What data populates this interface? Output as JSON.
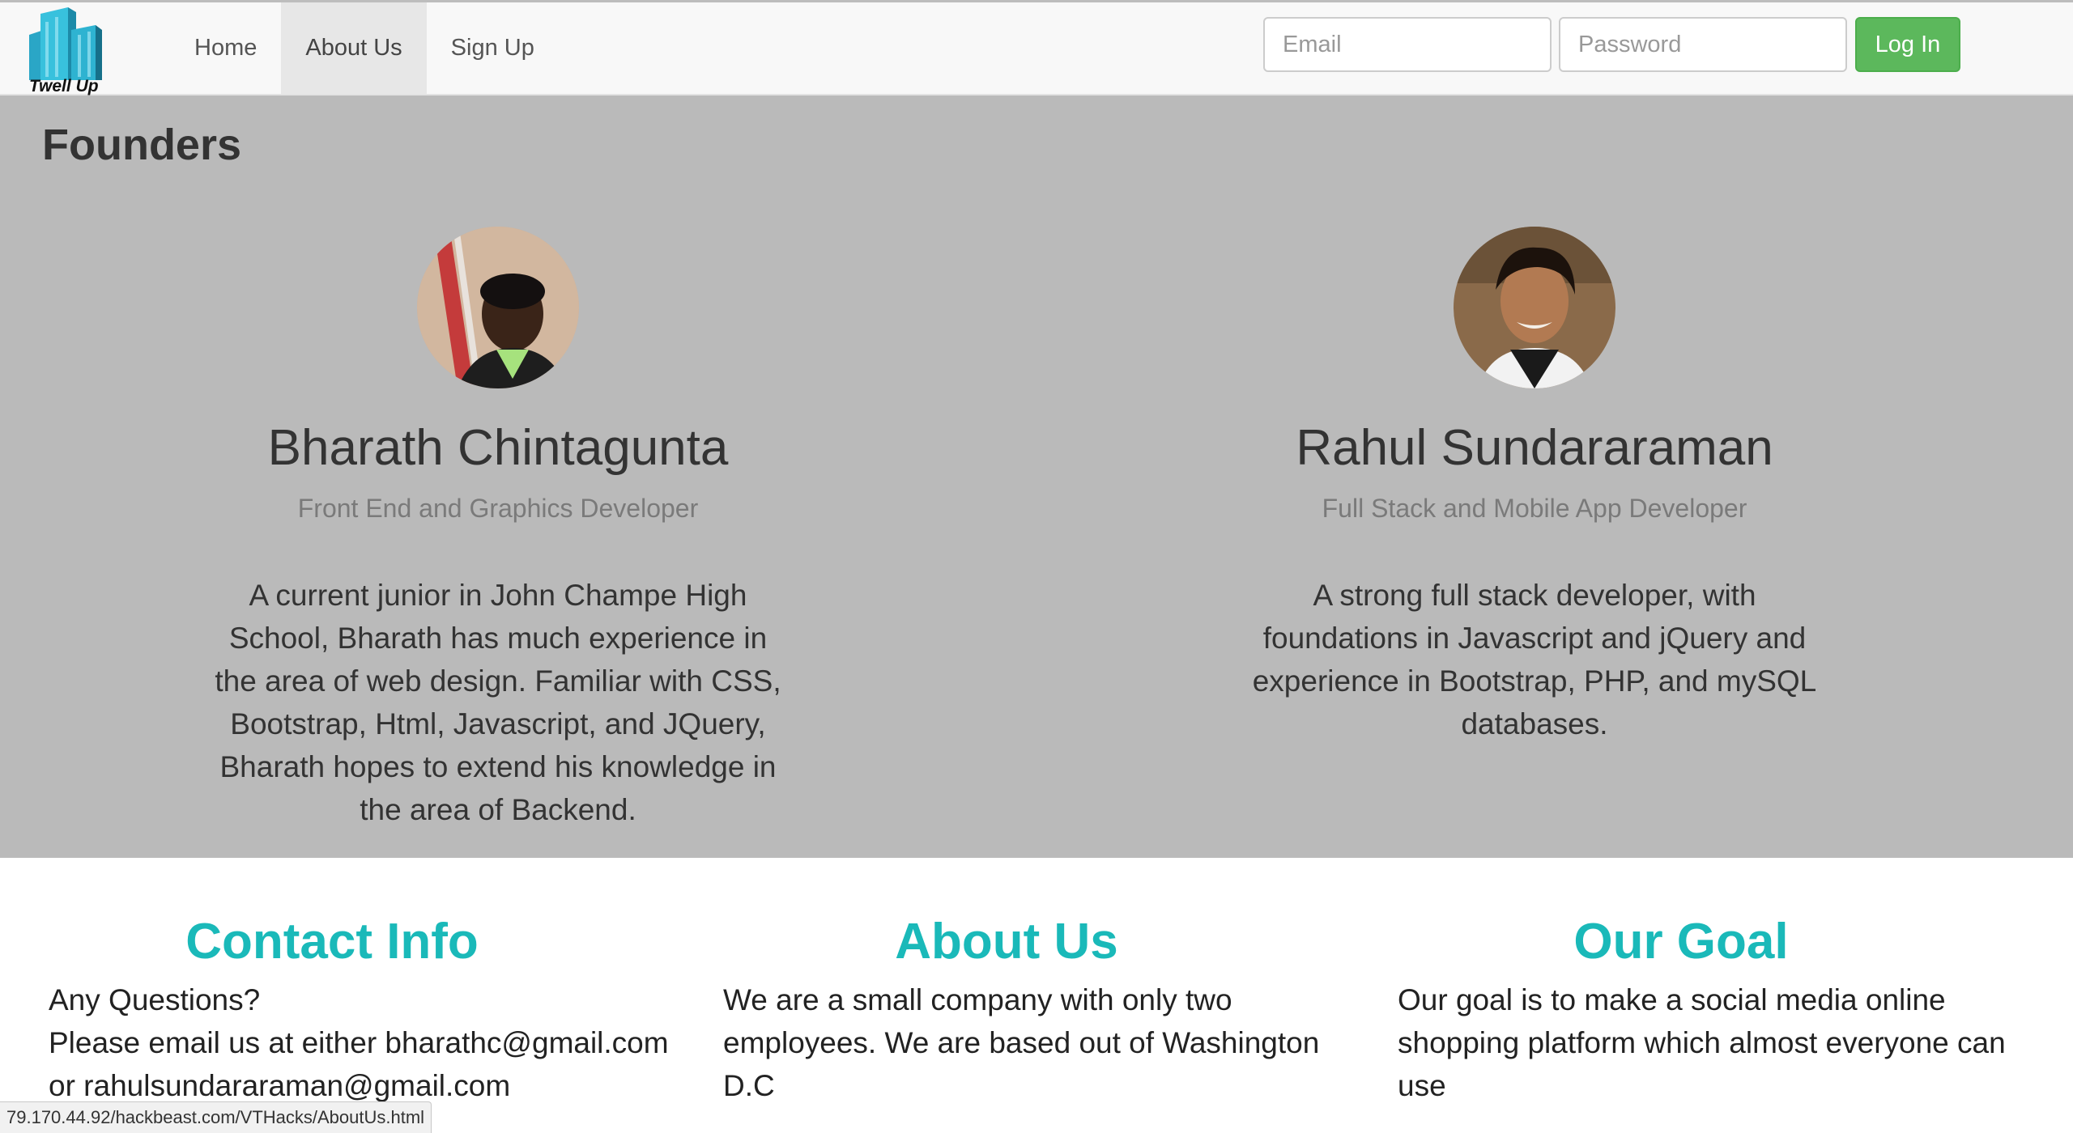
{
  "navbar": {
    "brand_name": "Twell Up",
    "links": [
      {
        "label": "Home",
        "active": false
      },
      {
        "label": "About Us",
        "active": true
      },
      {
        "label": "Sign Up",
        "active": false
      }
    ],
    "email_placeholder": "Email",
    "password_placeholder": "Password",
    "login_label": "Log In",
    "login_color": "#5cb85c"
  },
  "founders": {
    "title": "Founders",
    "background_color": "#bababa",
    "people": [
      {
        "name": "Bharath Chintagunta",
        "role": "Front End and Graphics Developer",
        "bio": "A current junior in John Champe High School, Bharath has much experience in the area of web design. Familiar with CSS, Bootstrap, Html, Javascript, and JQuery, Bharath hopes to extend his knowledge in the area of Backend."
      },
      {
        "name": "Rahul Sundararaman",
        "role": "Full Stack and Mobile App Developer",
        "bio": "A strong full stack developer, with foundations in Javascript and jQuery and experience in Bootstrap, PHP, and mySQL databases."
      }
    ]
  },
  "info": {
    "heading_color": "#1ab9b9",
    "contact": {
      "heading": "Contact Info",
      "line1": "Any Questions?",
      "line2": "Please email us at either bharathc@gmail.com",
      "line3": "or rahulsundararaman@gmail.com"
    },
    "about": {
      "heading": "About Us",
      "text": "We are a small company with only two employees. We are based out of Washington D.C"
    },
    "goal": {
      "heading": "Our Goal",
      "text": "Our goal is to make a social media online shopping platform which almost everyone can use"
    }
  },
  "statusbar": {
    "url": "79.170.44.92/hackbeast.com/VTHacks/AboutUs.html"
  }
}
